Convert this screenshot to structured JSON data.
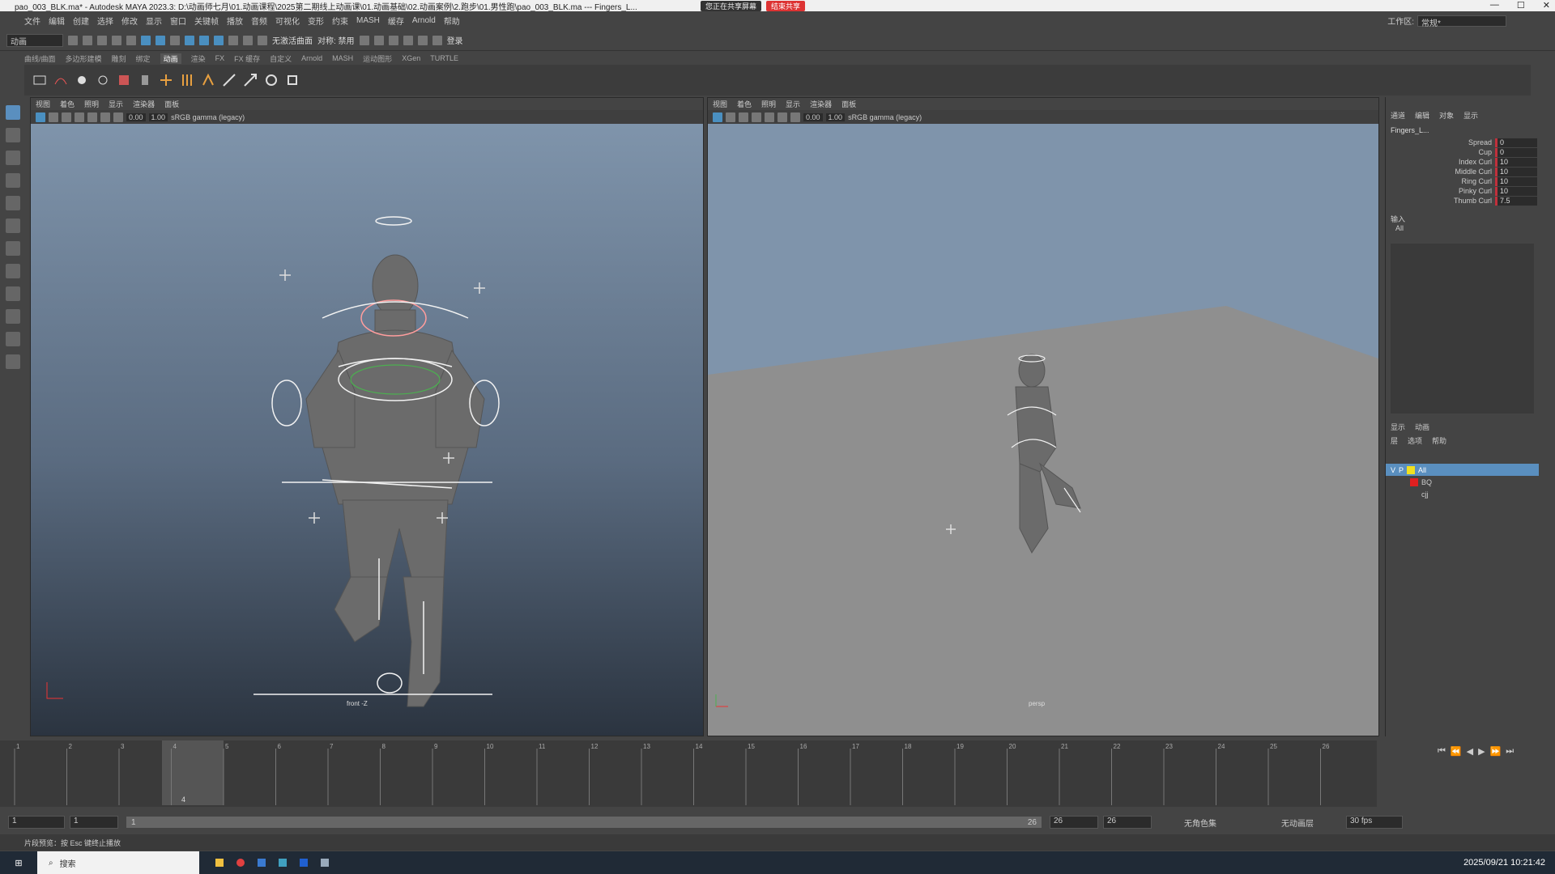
{
  "title_bar": {
    "text": "pao_003_BLK.ma* - Autodesk MAYA 2023.3: D:\\动画师七月\\01.动画课程\\2025第二期线上动画课\\01.动画基础\\02.动画案例\\2.跑步\\01.男性跑\\pao_003_BLK.ma  ---  Fingers_L...",
    "share_status": "您正在共享屏幕",
    "share_stop": "结束共享"
  },
  "menu_bar": [
    "文件",
    "编辑",
    "创建",
    "选择",
    "修改",
    "显示",
    "窗口",
    "关键帧",
    "播放",
    "音频",
    "可视化",
    "变形",
    "约束",
    "MASH",
    "缓存",
    "Arnold",
    "帮助"
  ],
  "workspace": {
    "label": "工作区:",
    "value": "常规*"
  },
  "status_line": {
    "mode": "动画",
    "no_live_surface": "无激活曲面",
    "symmetry": "对称: 禁用",
    "login": "登录"
  },
  "shelf_tabs": [
    "曲线/曲面",
    "多边形建模",
    "雕刻",
    "绑定",
    "动画",
    "渲染",
    "FX",
    "FX 缓存",
    "自定义",
    "Arnold",
    "MASH",
    "运动图形",
    "XGen",
    "TURTLE"
  ],
  "shelf_active": "动画",
  "viewport_left": {
    "menu": [
      "视图",
      "着色",
      "照明",
      "显示",
      "渲染器",
      "面板"
    ],
    "exposure": "0.00",
    "gamma": "1.00",
    "color_space": "sRGB gamma (legacy)",
    "camera": "front -Z"
  },
  "viewport_right": {
    "menu": [
      "视图",
      "着色",
      "照明",
      "显示",
      "渲染器",
      "面板"
    ],
    "exposure": "0.00",
    "gamma": "1.00",
    "color_space": "sRGB gamma (legacy)",
    "camera": "persp"
  },
  "channel_box": {
    "tabs": [
      "通道",
      "编辑",
      "对象",
      "显示"
    ],
    "node": "Fingers_L...",
    "attributes": [
      {
        "name": "Spread",
        "value": "0"
      },
      {
        "name": "Cup",
        "value": "0"
      },
      {
        "name": "Index Curl",
        "value": "10"
      },
      {
        "name": "Middle Curl",
        "value": "10"
      },
      {
        "name": "Ring Curl",
        "value": "10"
      },
      {
        "name": "Pinky Curl",
        "value": "10"
      },
      {
        "name": "Thumb Curl",
        "value": "7.5"
      }
    ],
    "inputs_label": "输入",
    "inputs_all": "All"
  },
  "layer_editor": {
    "tabs": [
      "显示",
      "动画"
    ],
    "menu": [
      "层",
      "选项",
      "帮助"
    ],
    "layers": [
      {
        "vis": "V",
        "playback": "P",
        "name": "All",
        "color": "#f0e020",
        "selected": true
      },
      {
        "vis": "",
        "playback": "",
        "name": "BQ",
        "color": "#e02020",
        "selected": false
      },
      {
        "vis": "",
        "playback": "",
        "name": "cjj",
        "color": "",
        "selected": false
      }
    ]
  },
  "time_slider": {
    "ticks": [
      "1",
      "2",
      "3",
      "4",
      "5",
      "6",
      "7",
      "8",
      "9",
      "10",
      "11",
      "12",
      "13",
      "14",
      "15",
      "16",
      "17",
      "18",
      "19",
      "20",
      "21",
      "22",
      "23",
      "24",
      "25",
      "26"
    ],
    "current_frame": "4",
    "playback_icons": [
      "⏮",
      "⏪",
      "◀",
      "▶",
      "⏩",
      "⏭"
    ]
  },
  "range_slider": {
    "start": "1",
    "anim_start": "1",
    "range_label": "1",
    "range_end_label": "26",
    "anim_end": "26",
    "end": "26",
    "no_character": "无角色集",
    "no_anim_layer": "无动画层",
    "fps": "30 fps"
  },
  "command_line": "片段预览：按 Esc 键终止播放",
  "taskbar": {
    "search": "搜索",
    "time": "2025/09/21 10:21:42"
  }
}
